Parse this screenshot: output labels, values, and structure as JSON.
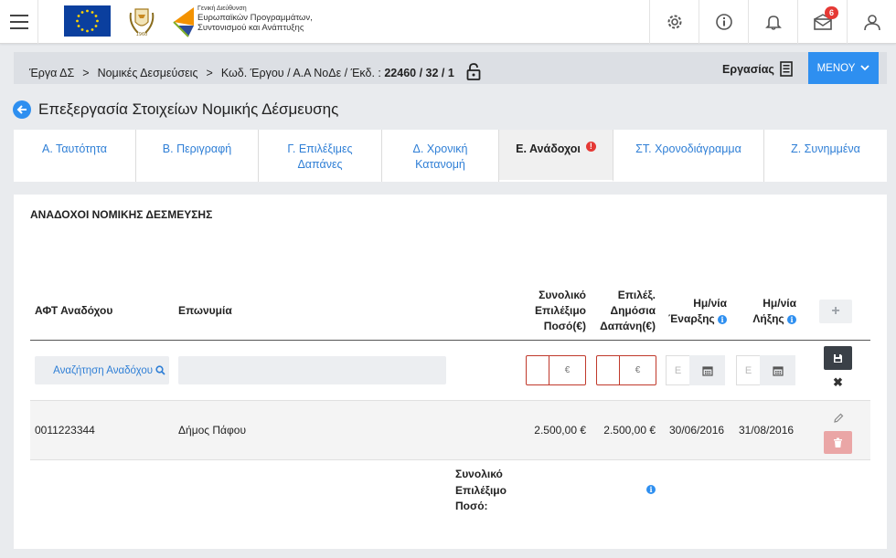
{
  "topbar": {
    "gd_line1": "Γενική Διεύθυνση",
    "gd_line2": "Ευρωπαϊκών Προγραμμάτων,",
    "gd_line3": "Συντονισμού και Ανάπτυξης",
    "notification_count": "6",
    "icons": [
      "menu-icon",
      "gear-icon",
      "info-icon",
      "bell-icon",
      "mail-icon",
      "user-icon"
    ]
  },
  "breadcrumb": {
    "item1": "Έργα ΔΣ",
    "item2": "Νομικές Δεσμεύσεις",
    "item3_prefix": "Κωδ. Έργου / Α.Α ΝοΔε / Έκδ. :",
    "item3_value": "22460 / 32 / 1",
    "ergasias": "Εργασίας",
    "menu": "ΜΕΝΟΥ"
  },
  "page": {
    "title": "Επεξεργασία Στοιχείων Νομικής Δέσμευσης"
  },
  "tabs": [
    {
      "label": "Α. Ταυτότητα"
    },
    {
      "label": "Β. Περιγραφή"
    },
    {
      "label": "Γ. Επιλέξιμες Δαπάνες"
    },
    {
      "label": "Δ. Χρονική Κατανομή"
    },
    {
      "label": "Ε. Ανάδοχοι",
      "active": true,
      "error": "!"
    },
    {
      "label": "ΣΤ. Χρονοδιάγραμμα"
    },
    {
      "label": "Ζ. Συνημμένα"
    }
  ],
  "panel": {
    "title": "ΑΝΑΔΟΧΟΙ ΝΟΜΙΚΗΣ ΔΕΣΜΕΥΣΗΣ",
    "headers": {
      "afm": "ΑΦΤ Αναδόχου",
      "name": "Επωνυμία",
      "total_line1": "Συνολικό",
      "total_line2": "Επιλέξιμο",
      "total_line3": "Ποσό(€)",
      "public_line1": "Επιλέξ.",
      "public_line2": "Δημόσια",
      "public_line3": "Δαπάνη(€)",
      "start_line1": "Ημ/νία",
      "start_line2": "Έναρξης",
      "end_line1": "Ημ/νία",
      "end_line2": "Λήξης"
    },
    "new_row": {
      "search_label": "Αναζήτηση Αναδόχου",
      "currency": "€",
      "date_placeholder": "Ε"
    },
    "rows": [
      {
        "afm": "0011223344",
        "name": "Δήμος Πάφου",
        "total": "2.500,00 €",
        "public": "2.500,00 €",
        "start": "30/06/2016",
        "end": "31/08/2016"
      }
    ],
    "footer": {
      "total_label_line1": "Συνολικό",
      "total_label_line2": "Επιλέξιμο",
      "total_label_line3": "Ποσό:"
    }
  },
  "colors": {
    "accent": "#2e8ff0",
    "error": "#e53935",
    "invalid_border": "#c0392b",
    "delete_bg": "#eaa6a6"
  }
}
